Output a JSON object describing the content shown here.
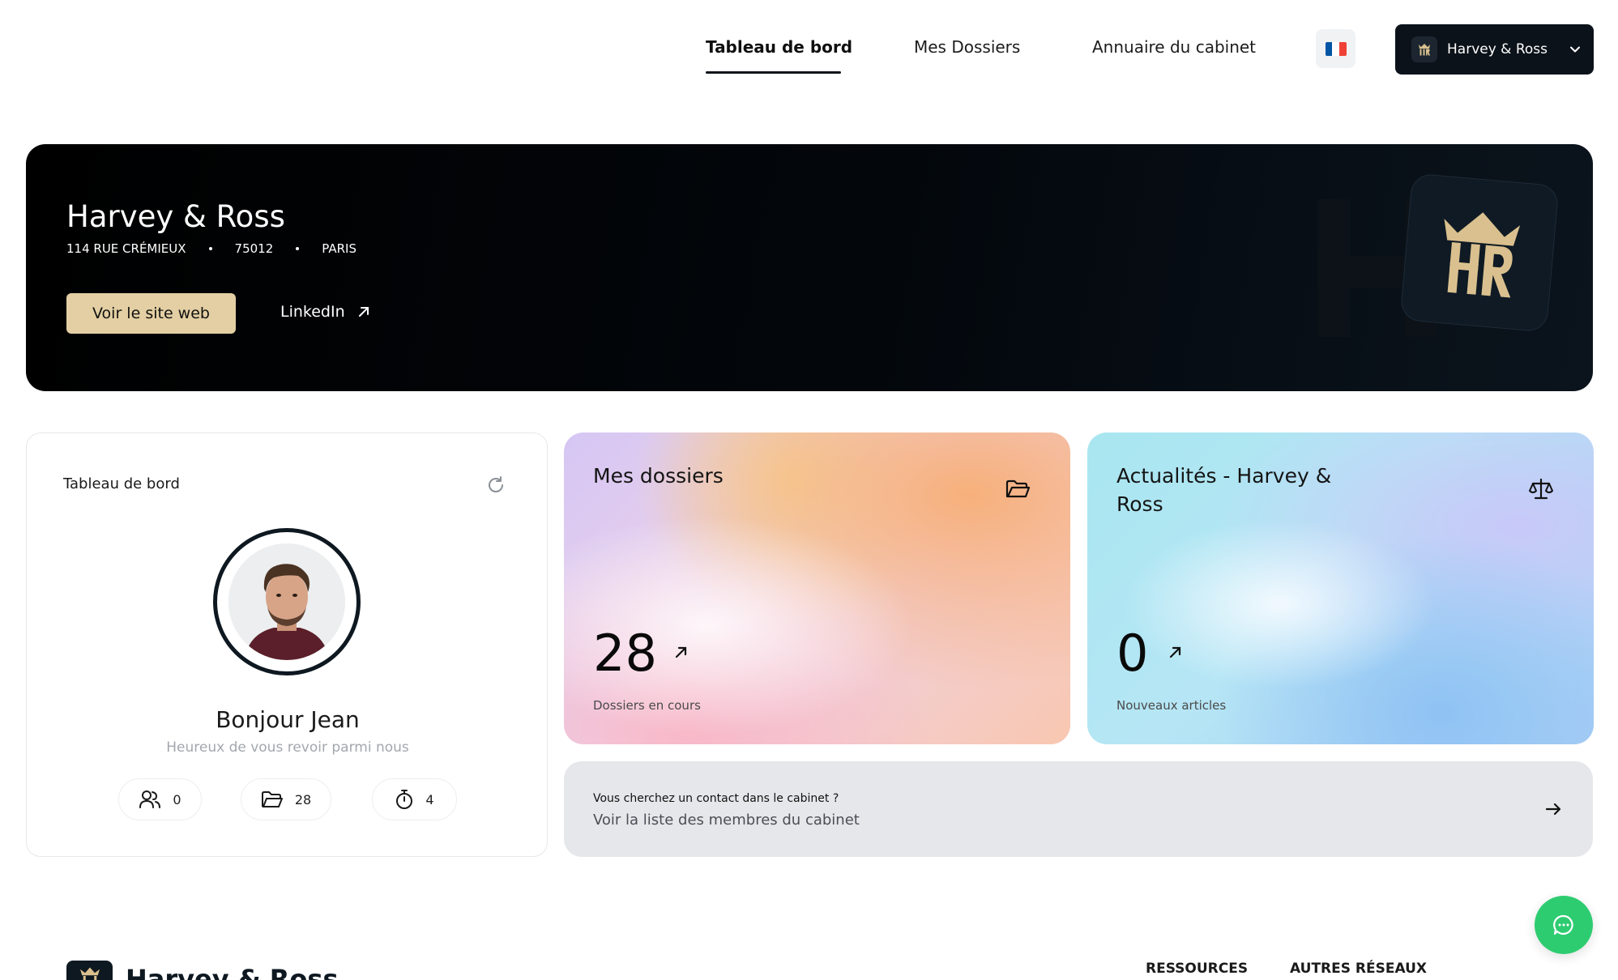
{
  "nav": {
    "links": [
      "Tableau de bord",
      "Mes Dossiers",
      "Annuaire du cabinet"
    ],
    "active": "Tableau de bord",
    "language_flag_colors": [
      "#0055a4",
      "#ffffff",
      "#ef4135"
    ],
    "firm_selector": {
      "label": "Harvey & Ross",
      "icon": "chevron-down-icon"
    }
  },
  "hero": {
    "name": "Harvey & Ross",
    "address": {
      "street": "114 RUE CRÉMIEUX",
      "zip": "75012",
      "city": "PARIS"
    },
    "website_button": "Voir le site web",
    "linkedin_link": "LinkedIn",
    "accent_color": "#e3cfa3"
  },
  "welcome": {
    "title": "Tableau de bord",
    "greeting": "Bonjour Jean",
    "subtitle": "Heureux de vous revoir parmi nous",
    "stats": [
      {
        "icon": "users-icon",
        "value": "0"
      },
      {
        "icon": "folder-icon",
        "value": "28"
      },
      {
        "icon": "timer-icon",
        "value": "4"
      }
    ]
  },
  "cards": {
    "dossiers": {
      "title": "Mes dossiers",
      "value": "28",
      "caption": "Dossiers en cours",
      "icon": "folder-open-icon"
    },
    "news": {
      "title": "Actualités - Harvey & Ross",
      "value": "0",
      "caption": "Nouveaux articles",
      "icon": "scales-icon"
    }
  },
  "contact": {
    "question": "Vous cherchez un contact dans le cabinet ?",
    "link": "Voir la liste des membres du cabinet"
  },
  "footer": {
    "name": "Harvey & Ross",
    "columns": [
      "RESSOURCES",
      "AUTRES RÉSEAUX"
    ]
  },
  "chat": {
    "icon": "chat-bubble-icon",
    "color": "#2ecc71"
  }
}
